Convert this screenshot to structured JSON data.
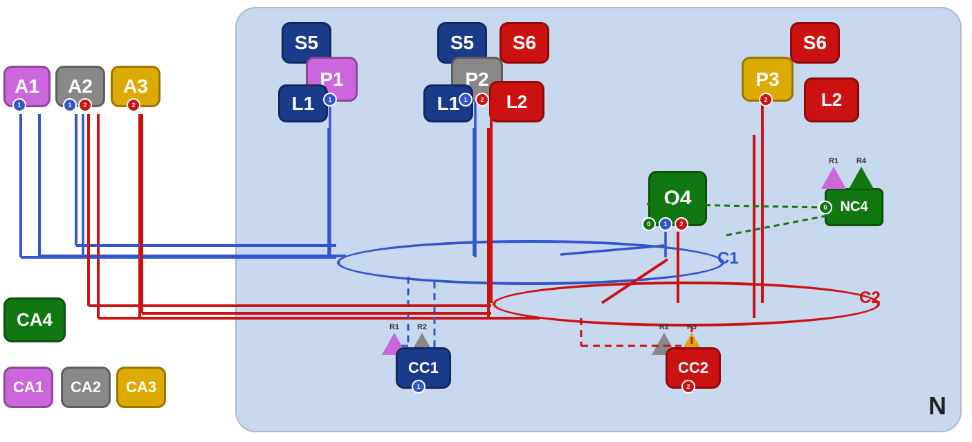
{
  "nodes": {
    "A1": {
      "label": "A1",
      "color": "purple"
    },
    "A2": {
      "label": "A2",
      "color": "gray"
    },
    "A3": {
      "label": "A3",
      "color": "gold"
    },
    "CA4": {
      "label": "CA4",
      "color": "green"
    },
    "CA1": {
      "label": "CA1",
      "color": "purple"
    },
    "CA2": {
      "label": "CA2",
      "color": "gray"
    },
    "CA3": {
      "label": "CA3",
      "color": "gold"
    },
    "S5a": {
      "label": "S5"
    },
    "P1": {
      "label": "P1"
    },
    "L1a": {
      "label": "L1"
    },
    "S5b": {
      "label": "S5"
    },
    "S6a": {
      "label": "S6"
    },
    "P2": {
      "label": "P2"
    },
    "L1b": {
      "label": "L1"
    },
    "L2a": {
      "label": "L2"
    },
    "S6b": {
      "label": "S6"
    },
    "P3": {
      "label": "P3"
    },
    "L2b": {
      "label": "L2"
    },
    "O4": {
      "label": "O4"
    },
    "NC4": {
      "label": "NC4"
    },
    "CC1": {
      "label": "CC1"
    },
    "CC2": {
      "label": "CC2"
    },
    "C1": {
      "label": "C1"
    },
    "C2": {
      "label": "C2"
    },
    "N": {
      "label": "N"
    }
  }
}
